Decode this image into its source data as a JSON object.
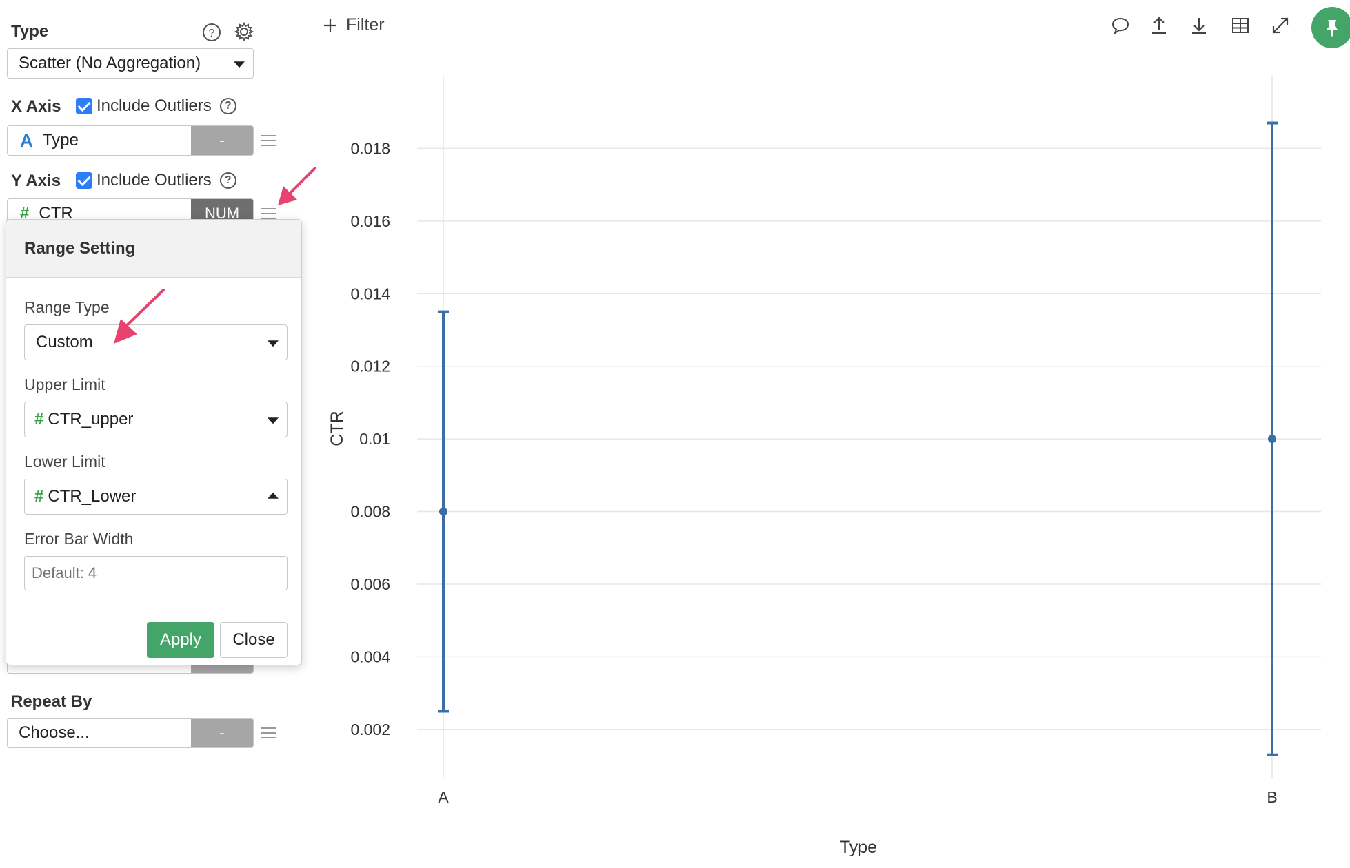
{
  "sidebar": {
    "type_label": "Type",
    "type_select": "Scatter (No Aggregation)",
    "x_axis": {
      "label": "X Axis",
      "include_outliers": "Include Outliers",
      "field_name": "Type",
      "field_icon": "A",
      "field_type": "-"
    },
    "y_axis": {
      "label": "Y Axis",
      "include_outliers": "Include Outliers",
      "field_name": "CTR",
      "field_icon": "#",
      "field_type": "NUM"
    },
    "repeat_by": {
      "label": "Repeat By",
      "field_name": "Choose...",
      "field_type": "-"
    }
  },
  "popover": {
    "title": "Range Setting",
    "range_type_label": "Range Type",
    "range_type_value": "Custom",
    "upper_limit_label": "Upper Limit",
    "upper_limit_value": "CTR_upper",
    "lower_limit_label": "Lower Limit",
    "lower_limit_value": "CTR_Lower",
    "error_bar_width_label": "Error Bar Width",
    "error_bar_width_placeholder": "Default: 4",
    "apply_label": "Apply",
    "close_label": "Close"
  },
  "toolbar": {
    "filter_label": "Filter",
    "icons": [
      "comment-icon",
      "upload-icon",
      "download-icon",
      "table-icon",
      "expand-icon",
      "pin-icon"
    ]
  },
  "colors": {
    "accent_green": "#44a569",
    "checkbox_blue": "#2e7cf6",
    "series_blue": "#3a6ea5",
    "annotation_pink": "#e8426e"
  },
  "chart_data": {
    "type": "scatter",
    "xlabel": "Type",
    "ylabel": "CTR",
    "categories": [
      "A",
      "B"
    ],
    "points": [
      {
        "x": "A",
        "y": 0.008,
        "upper": 0.0135,
        "lower": 0.0025
      },
      {
        "x": "B",
        "y": 0.01,
        "upper": 0.0187,
        "lower": 0.0013
      }
    ],
    "yticks": [
      0.002,
      0.004,
      0.006,
      0.008,
      0.01,
      0.012,
      0.014,
      0.016,
      0.018
    ],
    "ytick_labels": [
      "0.002",
      "0.004",
      "0.006",
      "0.008",
      "0.01",
      "0.012",
      "0.014",
      "0.016",
      "0.018"
    ],
    "ylim": [
      0.00065,
      0.02
    ],
    "grid": true
  }
}
